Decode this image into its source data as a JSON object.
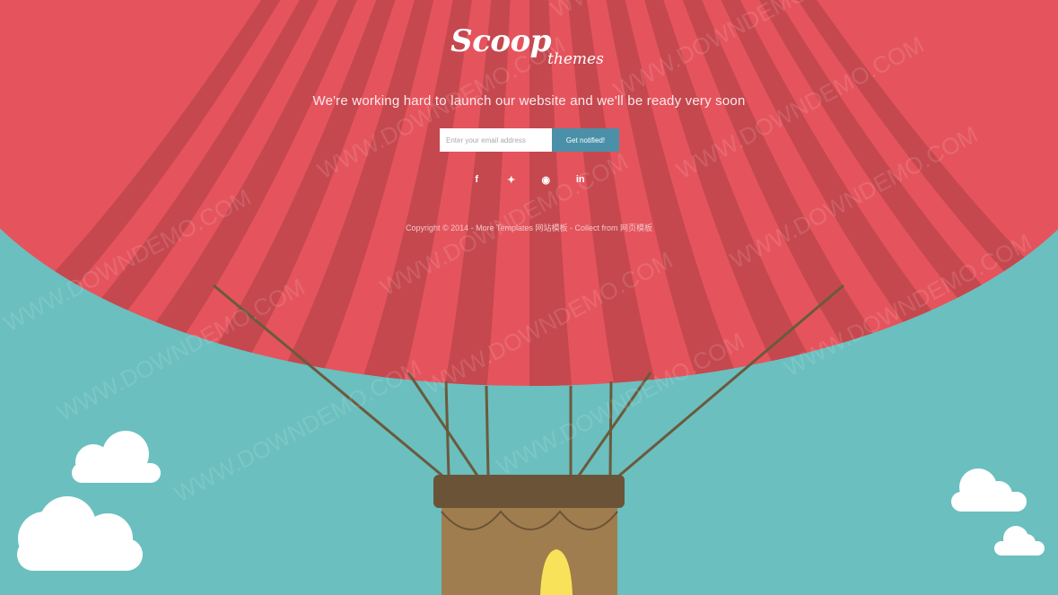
{
  "colors": {
    "sky": "#6bbfbf",
    "balloon_light": "#e5545d",
    "balloon_dark": "#c5484f",
    "basket": "#a07d4e",
    "basket_rim": "#6b5337",
    "rope": "#6b5a3c",
    "flame": "#f7e25a",
    "button": "#4a90a8"
  },
  "logo": {
    "main": "Scoop",
    "sub": "themes"
  },
  "tagline": "We're working hard to launch our website and we'll be ready very soon",
  "signup": {
    "placeholder": "Enter your email address",
    "button": "Get notified!"
  },
  "social": [
    {
      "icon": "facebook-icon",
      "glyph": "f"
    },
    {
      "icon": "twitter-icon",
      "glyph": "✦"
    },
    {
      "icon": "github-icon",
      "glyph": "◉"
    },
    {
      "icon": "linkedin-icon",
      "glyph": "in"
    }
  ],
  "footer": {
    "copyright": "Copyright © 2014 - ",
    "link1": "More Templates 网站模板",
    "sep": " - Collect from ",
    "link2": "网页模板"
  },
  "watermark": "WWW.DOWNDEMO.COM"
}
